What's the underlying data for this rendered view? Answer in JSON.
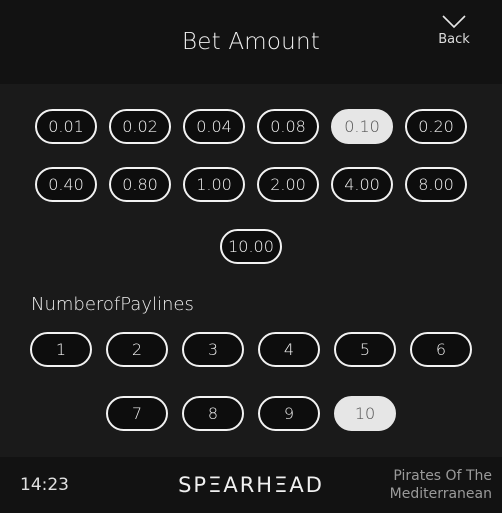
{
  "header": {
    "title": "Bet Amount",
    "back_label": "Back"
  },
  "bet_amounts": {
    "row1": [
      "0.01",
      "0.02",
      "0.04",
      "0.08",
      "0.10",
      "0.20"
    ],
    "row2": [
      "0.40",
      "0.80",
      "1.00",
      "2.00",
      "4.00",
      "8.00"
    ],
    "row3": [
      "10.00"
    ],
    "selected": "0.10"
  },
  "paylines": {
    "label": "NumberofPaylines",
    "row1": [
      "1",
      "2",
      "3",
      "4",
      "5",
      "6"
    ],
    "row2": [
      "7",
      "8",
      "9",
      "10"
    ],
    "selected": "10"
  },
  "footer": {
    "time": "14:23",
    "brand": "SPΞARHΞAD",
    "game_line1": "Pirates Of The",
    "game_line2": "Mediterranean"
  }
}
